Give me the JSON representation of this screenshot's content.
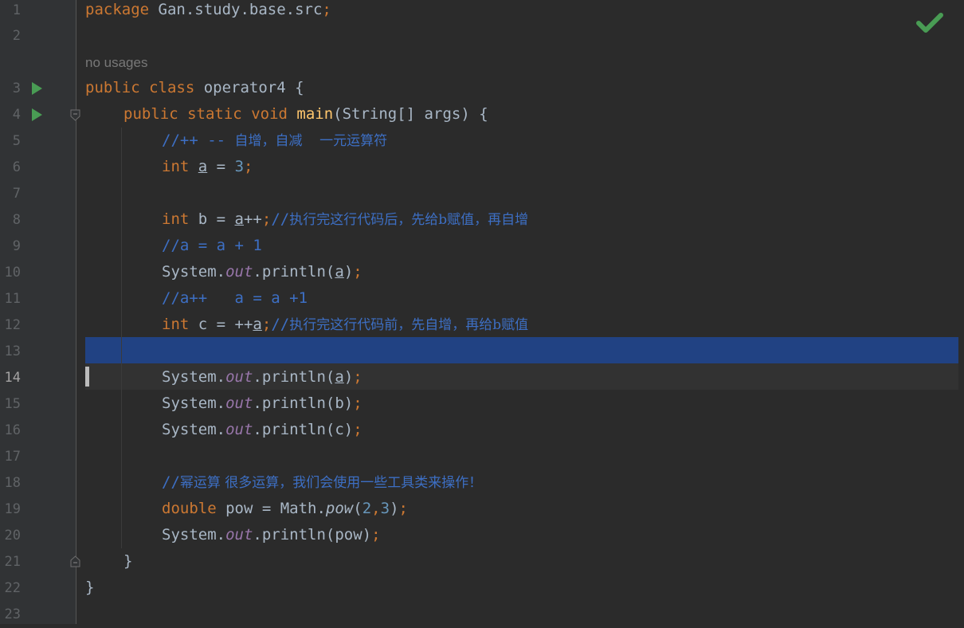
{
  "gutter": {
    "line_numbers": [
      "1",
      "2",
      "3",
      "4",
      "5",
      "6",
      "7",
      "8",
      "9",
      "10",
      "11",
      "12",
      "13",
      "14",
      "15",
      "16",
      "17",
      "18",
      "19",
      "20",
      "21",
      "22",
      "23"
    ],
    "current_line": "14"
  },
  "editor": {
    "inlay_hint": "no usages",
    "inspection_status": "no-problems-check-icon",
    "l1": {
      "kw": "package",
      "rest": " Gan.study.base.src",
      "semi": ";"
    },
    "l3": {
      "kw1": "public",
      "kw2": "class",
      "name": " operator4 {"
    },
    "l4": {
      "kw1": "public",
      "kw2": "static",
      "kw3": "void",
      "fn": "main",
      "rest": "(String[] args) {"
    },
    "l5": {
      "a": "//++ -- ",
      "b": "自增，自减    一元运算符"
    },
    "l6": {
      "kw": "int",
      "var": "a",
      "eq": " = ",
      "num": "3",
      "semi": ";"
    },
    "l8": {
      "kw": "int",
      "pre": " b = ",
      "var": "a",
      "post": "++",
      "semi": ";",
      "c1": "//",
      "c2": "执行完这行代码后，先给b赋值，再自增"
    },
    "l9": {
      "cm": "//a = a + 1"
    },
    "l10": {
      "sys": "System.",
      "out": "out",
      "call": ".println(",
      "var": "a",
      "close": ")",
      "semi": ";"
    },
    "l11": {
      "cm": "//a++   a = a +1"
    },
    "l12": {
      "kw": "int",
      "pre": " c = ++",
      "var": "a",
      "semi": ";",
      "c1": "//",
      "c2": "执行完这行代码前，先自增，再给b赋值"
    },
    "l14": {
      "sys": "System.",
      "out": "out",
      "call": ".println(",
      "var": "a",
      "close": ")",
      "semi": ";"
    },
    "l15": {
      "sys": "System.",
      "out": "out",
      "call": ".println(b)",
      "semi": ";"
    },
    "l16": {
      "sys": "System.",
      "out": "out",
      "call": ".println(c)",
      "semi": ";"
    },
    "l18": {
      "c1": "//",
      "c2": "幂运算 很多运算，我们会使用一些工具类来操作！"
    },
    "l19": {
      "kw": "double",
      "pre": " pow = Math.",
      "fn": "pow",
      "open": "(",
      "n1": "2",
      "comma": ",",
      "n2": "3",
      "close": ")",
      "semi": ";"
    },
    "l20": {
      "sys": "System.",
      "out": "out",
      "call": ".println(pow)",
      "semi": ";"
    },
    "l21": {
      "brace": "}"
    },
    "l22": {
      "brace": "}"
    }
  }
}
